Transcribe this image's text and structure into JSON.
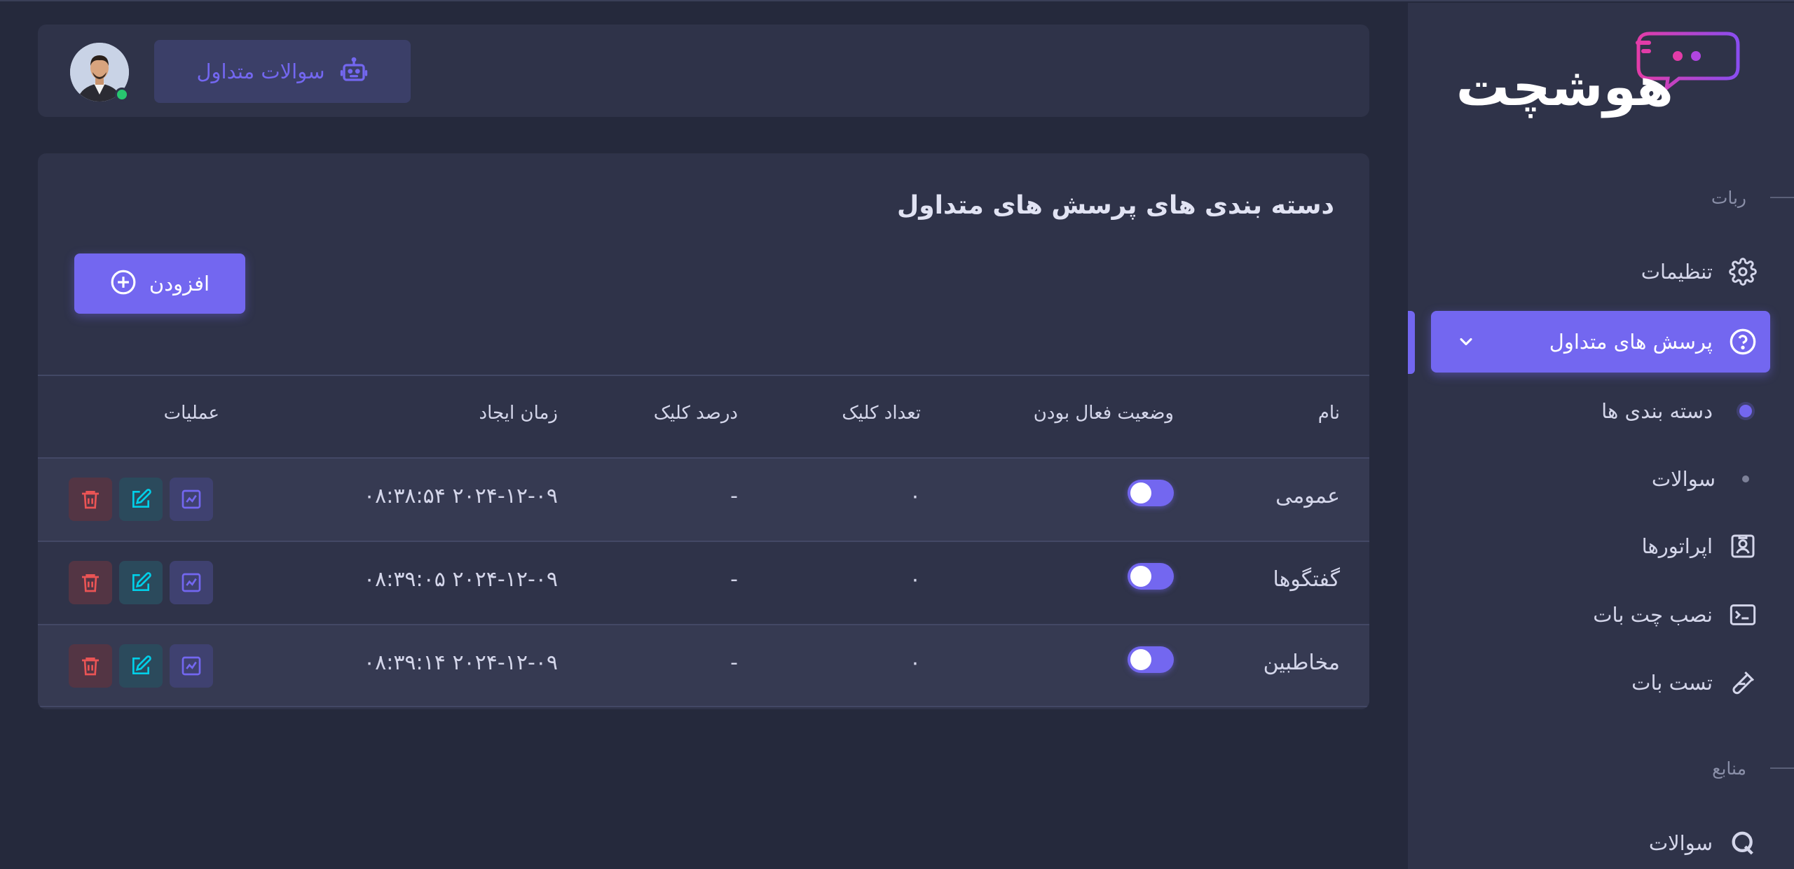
{
  "brand": {
    "name": "هوشچت"
  },
  "sidebar": {
    "section_bot": "ربات",
    "section_resources": "منابع",
    "items": {
      "settings": "تنظیمات",
      "faq": "پرسش های متداول",
      "categories": "دسته بندی ها",
      "questions": "سوالات",
      "operators": "اپراتورها",
      "install": "نصب چت بات",
      "test": "تست بات",
      "res_questions": "سوالات"
    }
  },
  "navbar": {
    "pill_label": "سوالات متداول"
  },
  "card": {
    "title": "دسته بندی های پرسش های متداول",
    "add_label": "افزودن"
  },
  "table": {
    "columns": {
      "name": "نام",
      "status": "وضعیت فعال بودن",
      "clicks": "تعداد کلیک",
      "click_pct": "درصد کلیک",
      "created": "زمان ایجاد",
      "actions": "عملیات"
    },
    "rows": [
      {
        "name": "عمومی",
        "active": true,
        "clicks": "۰",
        "click_pct": "-",
        "created": "۲۰۲۴-۱۲-۰۹ ۰۸:۳۸:۵۴"
      },
      {
        "name": "گفتگوها",
        "active": true,
        "clicks": "۰",
        "click_pct": "-",
        "created": "۲۰۲۴-۱۲-۰۹ ۰۸:۳۹:۰۵"
      },
      {
        "name": "مخاطبین",
        "active": true,
        "clicks": "۰",
        "click_pct": "-",
        "created": "۲۰۲۴-۱۲-۰۹ ۰۸:۳۹:۱۴"
      }
    ]
  },
  "colors": {
    "primary": "#7367f0",
    "sidebar_bg": "#2f3349",
    "page_bg": "#25293c",
    "danger": "#ea5455",
    "info": "#00cfe8",
    "success": "#28c76f"
  },
  "icons": {
    "settings": "gear-icon",
    "faq": "question-circle-icon",
    "operators": "user-badge-icon",
    "install": "terminal-icon",
    "test": "test-tube-icon",
    "res_questions": "q-icon",
    "pill": "robot-icon",
    "add": "plus-circle-icon",
    "stats": "chart-line-icon",
    "edit": "edit-icon",
    "delete": "trash-icon"
  }
}
